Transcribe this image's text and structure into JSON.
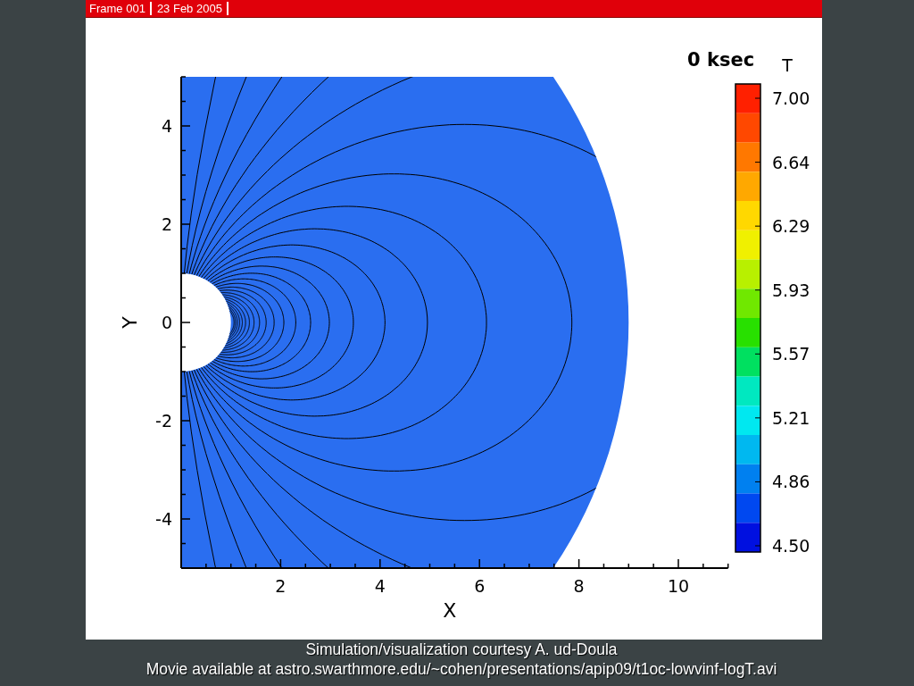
{
  "frame_header": {
    "frame": "Frame 001",
    "date": "23 Feb 2005"
  },
  "plot": {
    "time_label": "0 ksec",
    "x_axis": {
      "title": "X",
      "ticks": [
        "2",
        "4",
        "6",
        "8",
        "10"
      ]
    },
    "y_axis": {
      "title": "Y",
      "ticks": [
        "4",
        "2",
        "0",
        "-2",
        "-4"
      ]
    }
  },
  "legend": {
    "title": "T",
    "labels": [
      "7.00",
      "6.64",
      "6.29",
      "5.93",
      "5.57",
      "5.21",
      "4.86",
      "4.50"
    ],
    "swatches": [
      {
        "color": "#ff2000"
      },
      {
        "color": "#ff4800"
      },
      {
        "color": "#ff7800"
      },
      {
        "color": "#ffa800"
      },
      {
        "color": "#ffd800"
      },
      {
        "color": "#f0f000"
      },
      {
        "color": "#b8f000"
      },
      {
        "color": "#70e800"
      },
      {
        "color": "#28e000"
      },
      {
        "color": "#00e060"
      },
      {
        "color": "#00e8c0"
      },
      {
        "color": "#00e8f0"
      },
      {
        "color": "#00b8f0"
      },
      {
        "color": "#0080f0"
      },
      {
        "color": "#0048f0"
      },
      {
        "color": "#0010e0"
      }
    ]
  },
  "captions": [
    "Simulation/visualization courtesy A. ud-Doula",
    "Movie available at astro.swarthmore.edu/~cohen/presentations/apip09/t1oc-lowvinf-logT.avi"
  ]
}
